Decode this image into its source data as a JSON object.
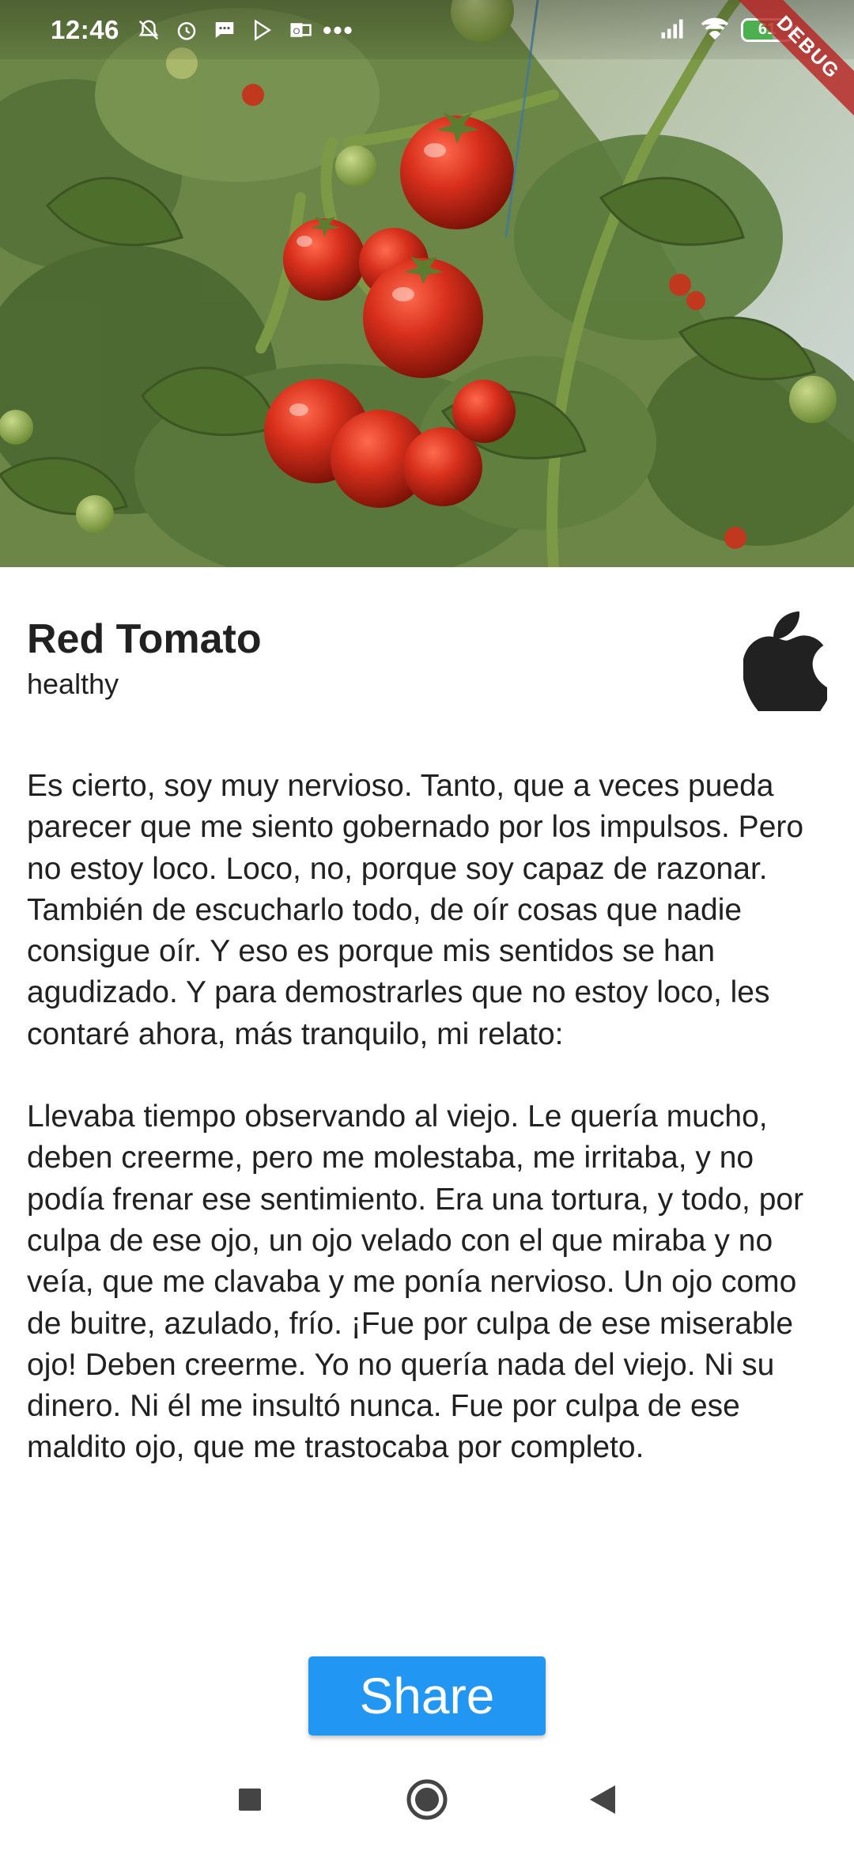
{
  "status_bar": {
    "time": "12:46",
    "left_icons": [
      "muted-bell-icon",
      "alarm-icon",
      "message-icon",
      "play-store-icon",
      "outlook-icon"
    ],
    "more_indicator": "•••",
    "right_icons": [
      "signal-icon",
      "wifi-icon",
      "battery-icon"
    ],
    "battery_level": "61",
    "debug_banner": "DEBUG"
  },
  "hero": {
    "image_subject": "red cherry tomatoes on the vine in a greenhouse"
  },
  "item": {
    "title": "Red Tomato",
    "subtitle": "healthy",
    "icon": "apple-icon"
  },
  "description": {
    "paragraph_1": "Es cierto, soy muy nervioso. Tanto, que a veces pueda parecer que me siento gobernado por los impulsos. Pero no estoy loco. Loco, no, porque soy capaz de razonar. También de escucharlo todo, de oír cosas que nadie consigue oír. Y eso es porque mis sentidos se han agudizado. Y para demostrarles que no estoy loco, les contaré ahora, más tranquilo, mi relato:",
    "paragraph_2": "Llevaba tiempo observando al viejo. Le quería mucho, deben creerme, pero me molestaba, me irritaba, y no podía frenar ese sentimiento. Era una tortura, y todo, por culpa de ese ojo, un ojo velado con el que miraba y no veía, que me clavaba y me ponía nervioso. Un ojo como de buitre, azulado, frío. ¡Fue por culpa de ese miserable ojo! Deben creerme. Yo no quería nada del viejo. Ni su dinero. Ni él me insultó nunca. Fue por culpa de ese maldito ojo, que me trastocaba por completo."
  },
  "actions": {
    "share_label": "Share"
  },
  "nav_bar": {
    "items": [
      "recent-apps-icon",
      "home-icon",
      "back-icon"
    ]
  },
  "colors": {
    "accent": "#2196f3",
    "text": "#212121",
    "tomato": "#d32f1f",
    "leaf": "#4e6e2c"
  }
}
